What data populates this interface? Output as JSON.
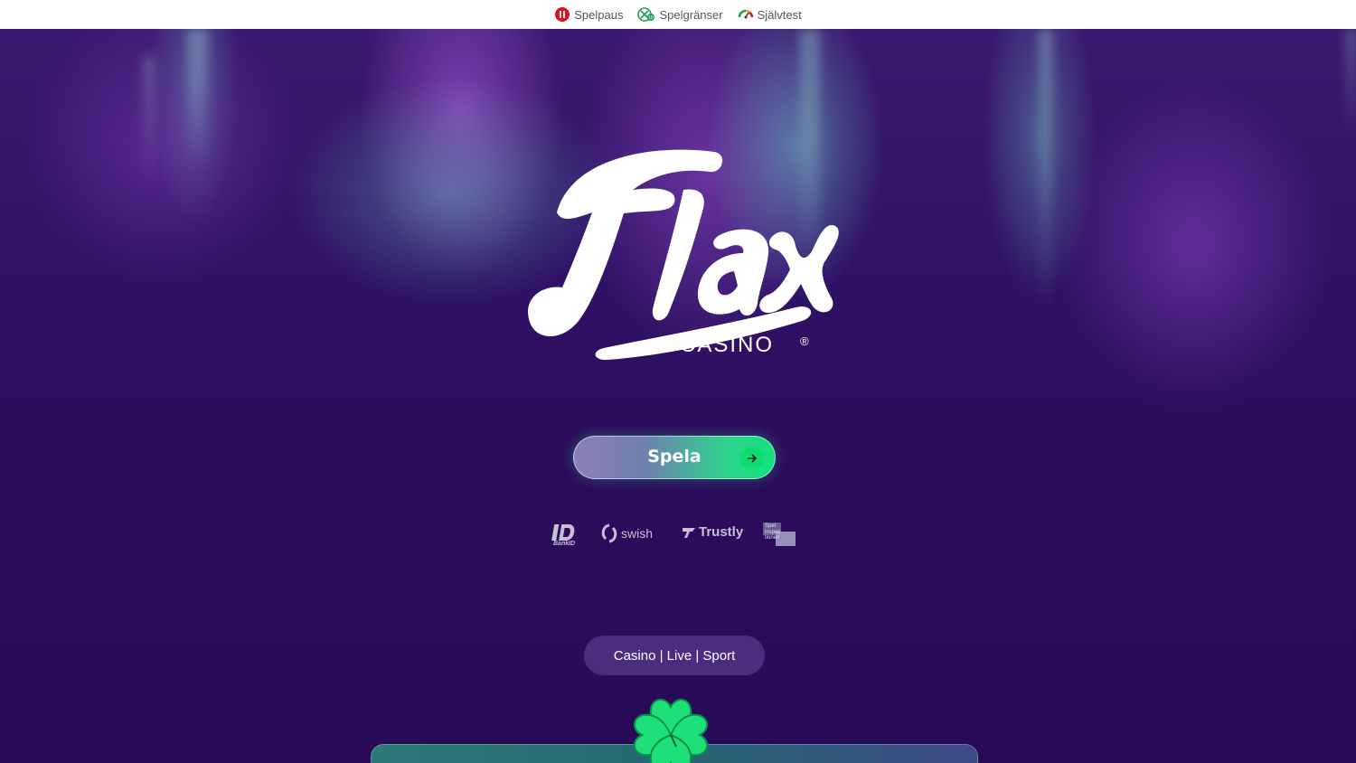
{
  "topbar": {
    "items": [
      {
        "label": "Spelpaus",
        "icon": "pause-icon",
        "color": "#e3101a"
      },
      {
        "label": "Spelgränser",
        "icon": "limits-icon",
        "color": "#1f9e4f"
      },
      {
        "label": "Självtest",
        "icon": "gauge-icon",
        "color": "#f4a81d"
      }
    ]
  },
  "hero": {
    "brand_logo": {
      "name": "Flax",
      "subtitle": "CASINO",
      "registered_mark": "®"
    },
    "play_button": {
      "label": "Spela",
      "icon": "arrow-right-icon"
    },
    "payment_logos": [
      {
        "name": "bankid-icon",
        "caption": "BankID"
      },
      {
        "name": "swish-icon",
        "label": "swish"
      },
      {
        "name": "trustly-icon",
        "label": "Trustly"
      },
      {
        "name": "spelinspektionen-icon",
        "lines": [
          "Spel",
          "inspek",
          "tionen"
        ]
      }
    ],
    "categories": "Casino | Live | Sport"
  },
  "colors": {
    "accent_green": "#12e27d",
    "background_purple": "#2a0e5c",
    "pill_purple": "#4a2d7e"
  }
}
